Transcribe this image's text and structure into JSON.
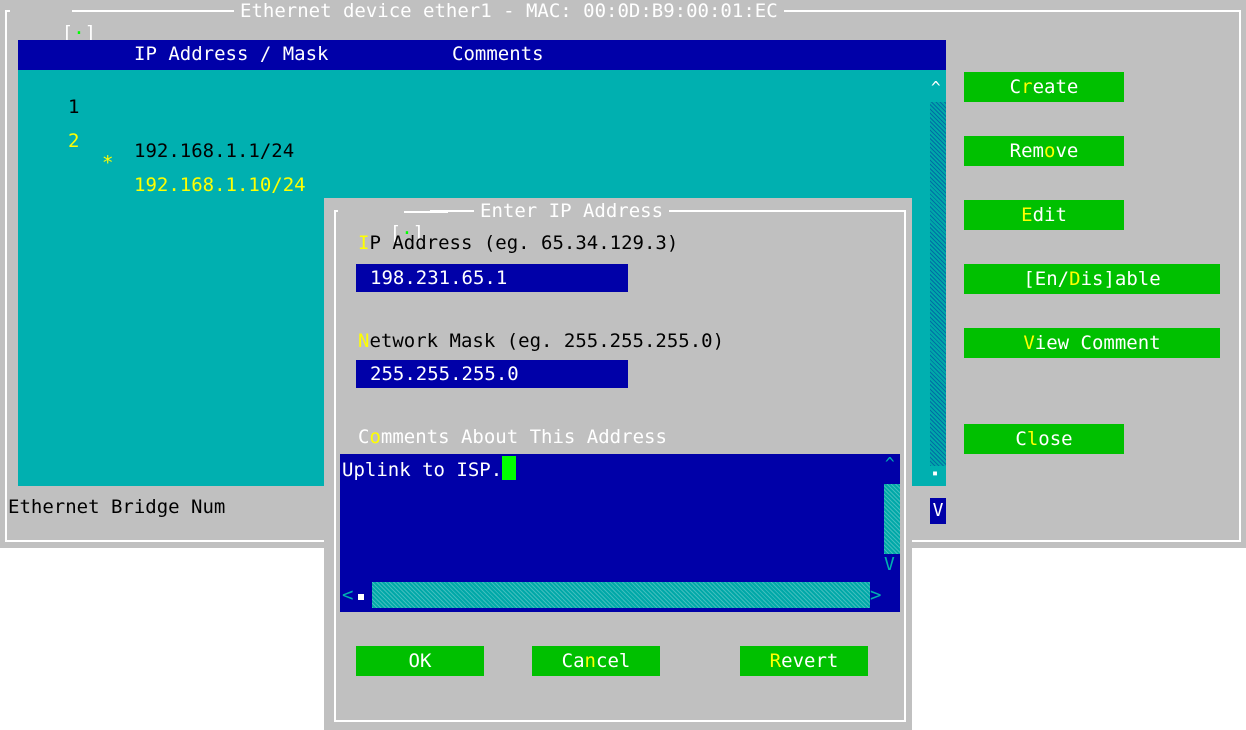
{
  "main_window": {
    "title": "Ethernet device ether1 - MAC: 00:0D:B9:00:01:EC",
    "close_box": "[",
    "close_box_end": "]",
    "columns": {
      "ip": "IP Address / Mask",
      "comments": "Comments"
    },
    "rows": [
      {
        "num": "1",
        "flag": " ",
        "ip": "192.168.1.1/24"
      },
      {
        "num": "2",
        "flag": "*",
        "ip": "192.168.1.10/24"
      }
    ],
    "status": "Ethernet Bridge Num",
    "buttons": {
      "create": [
        "C",
        "r",
        "eate"
      ],
      "remove": [
        "Rem",
        "o",
        "ve"
      ],
      "edit": [
        "",
        "E",
        "dit"
      ],
      "enable": [
        "[En/",
        "D",
        "is]able"
      ],
      "view_comment": [
        "",
        "V",
        "iew Comment"
      ],
      "close": [
        "C",
        "l",
        "ose"
      ]
    },
    "scroll_up": "^",
    "scroll_down": "V",
    "scroll_thumb": "▪"
  },
  "dialog": {
    "title": "Enter IP Address",
    "ip_label": [
      "",
      "I",
      "P Address (eg. 65.34.129.3)"
    ],
    "ip_value": "198.231.65.1",
    "mask_label": [
      "",
      "N",
      "etwork Mask (eg. 255.255.255.0)"
    ],
    "mask_value": "255.255.255.0",
    "comments_label": [
      "C",
      "o",
      "mments About This Address"
    ],
    "comments_value": "Uplink to ISP.",
    "scroll_up": "^",
    "scroll_down": "V",
    "scroll_left": "<",
    "scroll_right": ">",
    "buttons": {
      "ok": [
        "",
        "O",
        "K"
      ],
      "cancel": [
        "Ca",
        "n",
        "cel"
      ],
      "revert": [
        "",
        "R",
        "evert"
      ]
    }
  },
  "colors": {
    "list_bg": "#00b0b0",
    "header_bg": "#0000a8",
    "button_bg": "#00c000",
    "hotkey": "#ffff00",
    "window_bg": "#c0c0c0"
  }
}
